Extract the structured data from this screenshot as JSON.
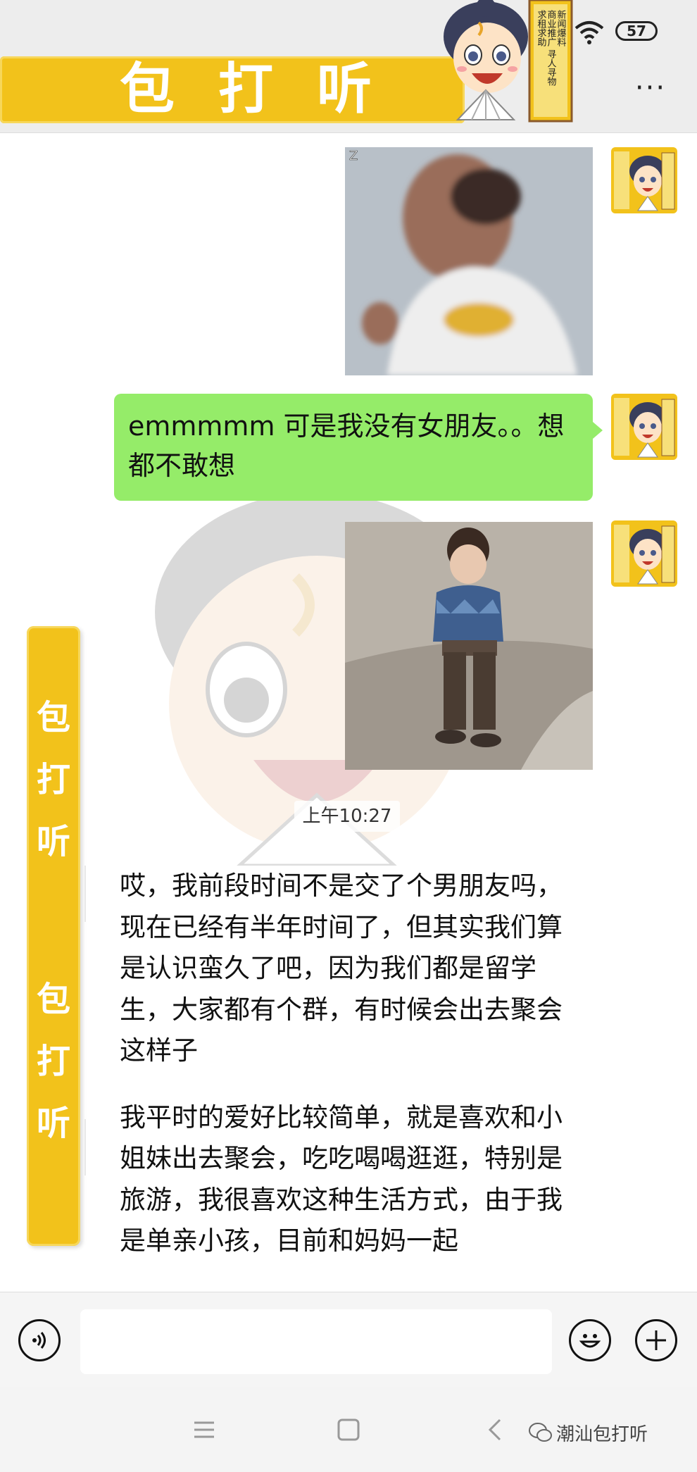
{
  "header": {
    "banner_text": "包打听",
    "mascot_sign_lines": [
      "新闻爆料",
      "寻人寻物",
      "求租求助",
      "商业推广"
    ],
    "battery": "57",
    "more_label": "···"
  },
  "messages": {
    "text_message": "emmmmm 可是我没有女朋友。。想都不敢想",
    "timestamp": "上午10:27",
    "image1_corner_label": "Z"
  },
  "side_banner": {
    "chars": [
      "包",
      "打",
      "听",
      "包",
      "打",
      "听"
    ]
  },
  "article": {
    "paragraphs": [
      "哎，我前段时间不是交了个男朋友吗，现在已经有半年时间了，但其实我们算是认识蛮久了吧，因为我们都是留学生，大家都有个群，有时候会出去聚会这样子",
      "我平时的爱好比较简单，就是喜欢和小姐妹出去聚会，吃吃喝喝逛逛，特别是旅游，我很喜欢这种生活方式，由于我是单亲小孩，目前和妈妈一起"
    ]
  },
  "watermark_text": "潮汕包打听",
  "colors": {
    "brand_yellow": "#f2c21b",
    "bubble_green": "#95ec69",
    "header_bg": "#ededed"
  },
  "icons": {
    "voice": "voice-icon",
    "emoji": "emoji-icon",
    "add": "plus-icon",
    "wifi": "wifi-icon",
    "nav_menu": "menu-icon",
    "nav_home": "home-icon",
    "nav_back": "back-icon"
  }
}
